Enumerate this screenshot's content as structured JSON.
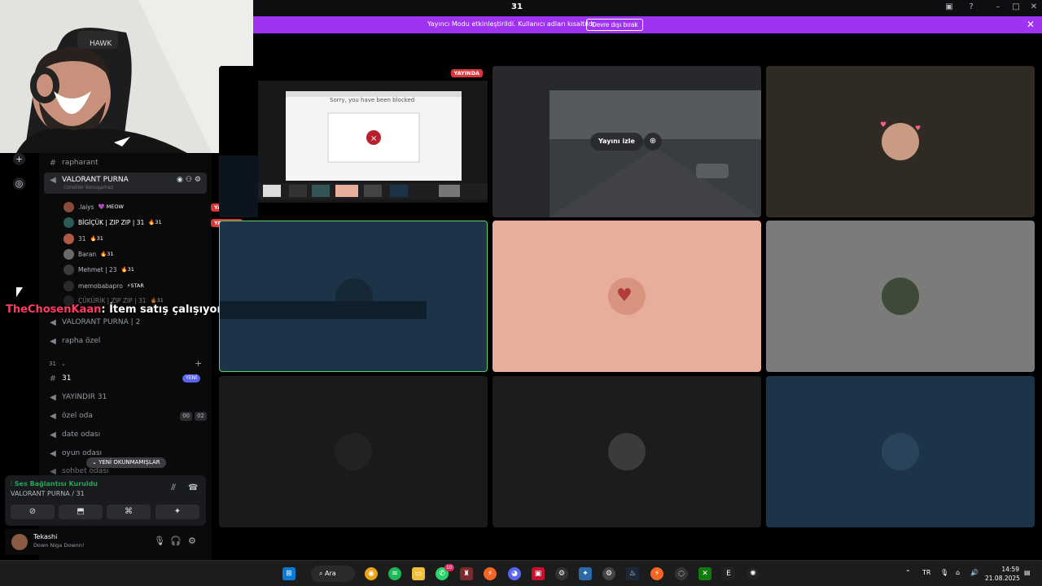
{
  "window": {
    "title": "31"
  },
  "banner": {
    "message": "Yayıncı Modu etkinleştirildi. Kullanıcı adları kısaltıldı.",
    "disable_button": "Devre dışı bırak"
  },
  "channels": {
    "items": [
      {
        "kind": "text",
        "label": "rapharant"
      },
      {
        "kind": "voice",
        "label": "VALORANT PURNA",
        "sub": "cizreliler konuşamaz",
        "active": true
      },
      {
        "kind": "voice",
        "label": "VALORANT PURNA | 2"
      },
      {
        "kind": "voice",
        "label": "rapha özel"
      }
    ],
    "category": {
      "label": "31",
      "caret": "⌄",
      "add": "+"
    },
    "category_items": [
      {
        "kind": "text",
        "label": "31",
        "badge": "YENİ"
      },
      {
        "kind": "voice",
        "label": "YAYINDIR 31"
      },
      {
        "kind": "voice",
        "label": "özel oda",
        "count_a": "00",
        "count_b": "02"
      },
      {
        "kind": "voice",
        "label": "date odası"
      },
      {
        "kind": "voice",
        "label": "oyun odası"
      },
      {
        "kind": "voice",
        "label": "sohbet odası"
      }
    ],
    "members": [
      {
        "name": ".laiys",
        "tag": "💜 MEOW"
      },
      {
        "name": "BİGİÇÜK | ZIP ZIP | 31",
        "tag": "🔥31",
        "live": "YAYINDA"
      },
      {
        "name": "31",
        "tag": "🔥31",
        "live": ""
      },
      {
        "name": "Baran",
        "tag": "🔥31"
      },
      {
        "name": "Mehmet | 23",
        "tag": "🔥31"
      },
      {
        "name": "memobabapro",
        "tag": "⚡STAR"
      },
      {
        "name": "ÇÜKÜRİK | ZIP ZIP | 31",
        "tag": "🔥31"
      }
    ],
    "first_member_live": "YAYINDA",
    "unread_pill": "⌄ YENİ OKUNMAMIŞLAR"
  },
  "overlay": {
    "name": "TheChosenKaan",
    "text": ": İtem satış çalışıyor"
  },
  "voice_panel": {
    "status": "Ses Bağlantısı Kuruldu",
    "location": "VALORANT PURNA / 31",
    "status_icon": "signal-icon"
  },
  "user": {
    "name": "Tekashi",
    "status": "Down Niga Downn!"
  },
  "stage": {
    "live_tag": "YAYINDA",
    "watch_label": "Yayını izle",
    "blocked_title": "Sorry, you have been blocked"
  },
  "taskbar": {
    "search_label": "Ara",
    "time": "14:59",
    "date": "21.08.2025",
    "badge_whatsapp": "10"
  },
  "colors": {
    "banner": "#a033f0",
    "live": "#da373c",
    "tile_blue": "#1d3448",
    "tile_peach": "#e6ae9b",
    "tile_gray": "#7b7b7b",
    "tile_dark": "#1a1a1a",
    "tile_brown": "#302a25"
  }
}
